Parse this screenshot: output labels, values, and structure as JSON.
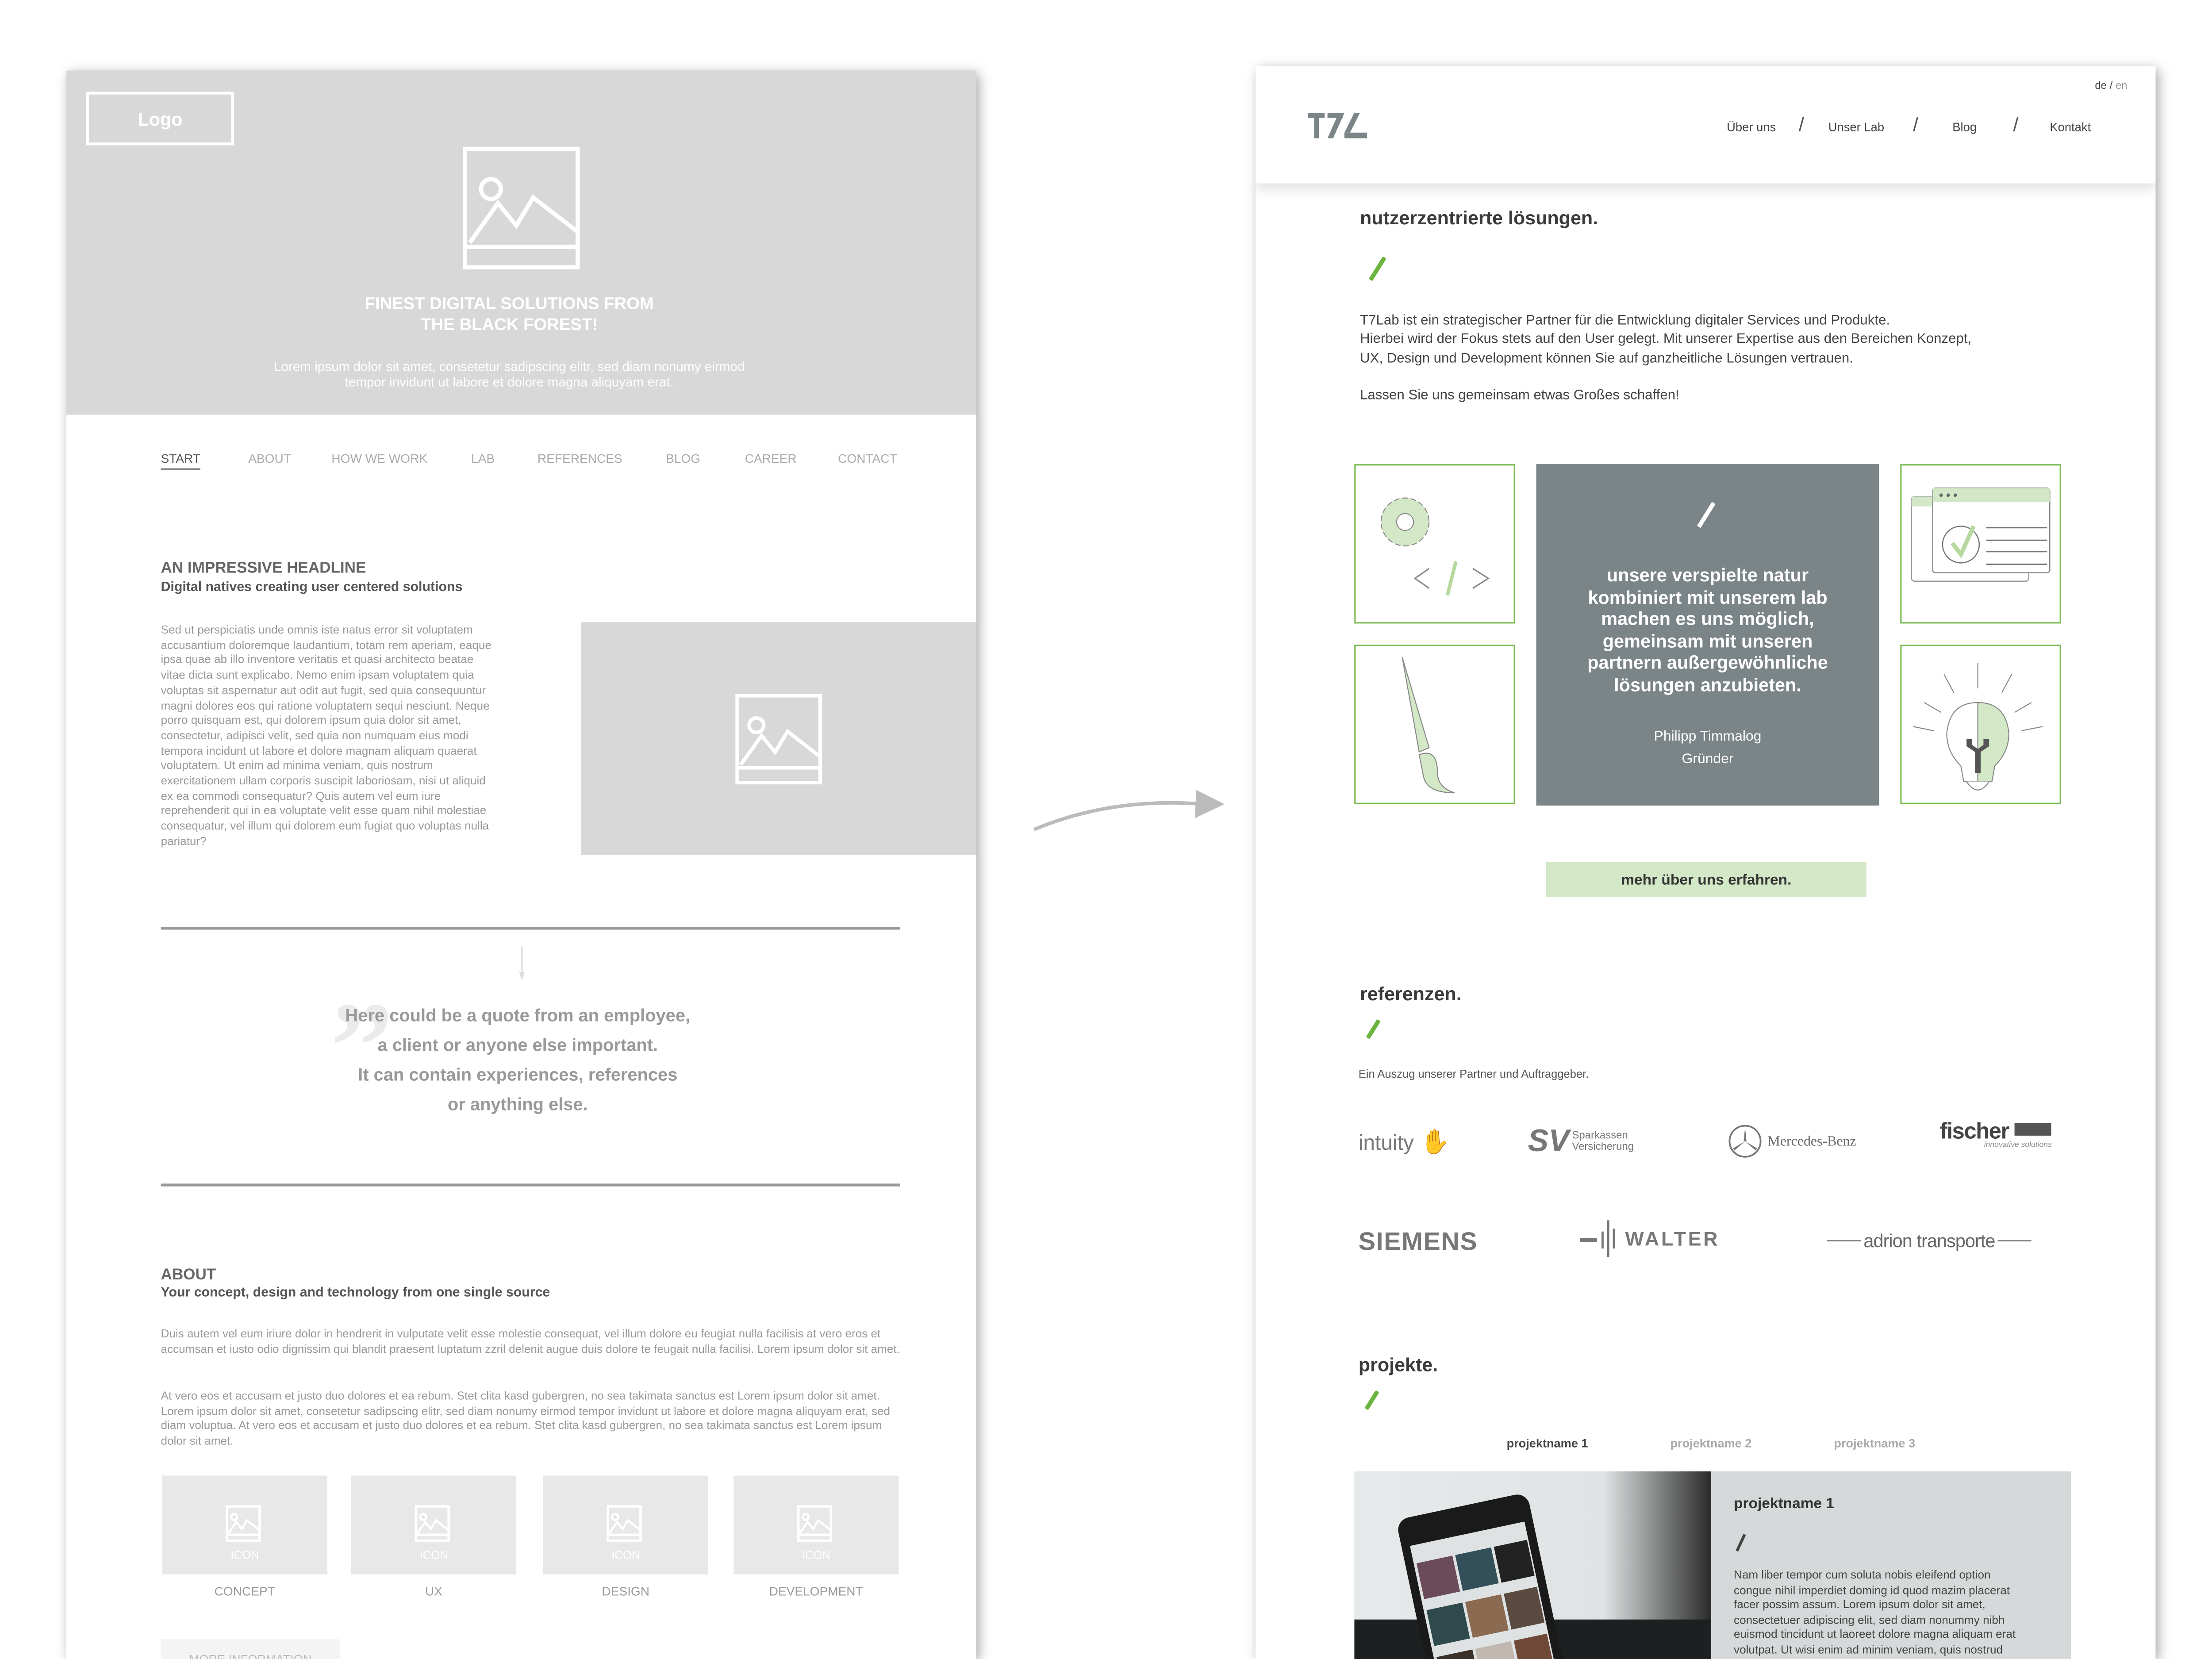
{
  "wireframe": {
    "logo": "Logo",
    "hero_title": [
      "FINEST DIGITAL SOLUTIONS FROM",
      "THE BLACK FOREST!"
    ],
    "hero_text": [
      "Lorem ipsum dolor sit amet, consetetur sadipscing elitr, sed diam nonumy eirmod",
      "tempor invidunt ut labore et dolore magna aliquyam erat."
    ],
    "nav": [
      "START",
      "ABOUT",
      "HOW WE WORK",
      "LAB",
      "REFERENCES",
      "BLOG",
      "CAREER",
      "CONTACT"
    ],
    "nav_active": "START",
    "headline": "AN IMPRESSIVE HEADLINE",
    "subheadline": "Digital natives creating user centered solutions",
    "body": "Sed ut perspiciatis unde omnis iste natus error sit voluptatem accusantium doloremque laudantium, totam rem aperiam, eaque ipsa quae ab illo inventore veritatis et quasi architecto beatae vitae dicta sunt explicabo. Nemo enim ipsam voluptatem quia voluptas sit aspernatur aut odit aut fugit, sed quia consequuntur magni dolores eos qui ratione voluptatem sequi nesciunt. Neque porro quisquam est, qui dolorem ipsum quia dolor sit amet, consectetur, adipisci velit, sed quia non numquam eius modi tempora incidunt ut labore et dolore magnam aliquam quaerat voluptatem. Ut enim ad minima veniam, quis nostrum exercitationem ullam corporis suscipit laboriosam, nisi ut aliquid ex ea commodi consequatur? Quis autem vel eum iure reprehenderit qui in ea voluptate velit esse quam nihil molestiae consequatur, vel illum qui dolorem eum fugiat quo voluptas nulla pariatur?",
    "quote": [
      "Here could be a quote from an employee,",
      "a client or anyone else important.",
      "It can contain experiences, references",
      "or anything else."
    ],
    "about_title": "ABOUT",
    "about_subtitle": "Your concept, design and technology from one single source",
    "about_p1": "Duis autem vel eum iriure dolor in hendrerit in vulputate velit esse molestie consequat, vel illum dolore eu feugiat nulla facilisis at vero eros et accumsan et iusto odio dignissim qui blandit praesent luptatum zzril delenit augue duis dolore te feugait nulla facilisi. Lorem ipsum dolor sit amet.",
    "about_p2": "At vero eos et accusam et justo duo dolores et ea rebum. Stet clita kasd gubergren, no sea takimata sanctus est Lorem ipsum dolor sit amet. Lorem ipsum dolor sit amet, consetetur sadipscing elitr, sed diam nonumy eirmod tempor invidunt ut labore et dolore magna aliquyam erat, sed diam voluptua. At vero eos et accusam et justo duo dolores et ea rebum. Stet clita kasd gubergren, no sea takimata sanctus est Lorem ipsum dolor sit amet.",
    "icon_placeholder": "ICON",
    "services": [
      "CONCEPT",
      "UX",
      "DESIGN",
      "DEVELOPMENT"
    ],
    "more_button": "MORE INFORMATION"
  },
  "design": {
    "lang": {
      "de": "de",
      "sep": "/",
      "en": "en"
    },
    "nav": [
      "Über uns",
      "Unser Lab",
      "Blog",
      "Kontakt"
    ],
    "intro_title": "nutzerzentrierte lösungen.",
    "intro_lines": [
      "T7Lab ist ein strategischer Partner für die Entwicklung digitaler Services und Produkte.",
      "Hierbei wird der Fokus stets auf den User gelegt. Mit unserer Expertise aus den Bereichen Konzept,",
      "UX, Design und Development können Sie auf ganzheitliche Lösungen vertrauen."
    ],
    "intro_cta_text": "Lassen Sie uns gemeinsam etwas Großes schaffen!",
    "quote_lines": [
      "unsere verspielte natur",
      "kombiniert mit unserem lab",
      "machen es uns möglich,",
      "gemeinsam mit unseren",
      "partnern außergewöhnliche",
      "lösungen  anzubieten."
    ],
    "quote_author": "Philipp Timmalog",
    "quote_role": "Gründer",
    "about_button": "mehr über uns erfahren.",
    "references_title": "referenzen.",
    "references_subtitle": "Ein Auszug unserer Partner und  Auftraggeber.",
    "reference_logos": {
      "intuity": "intuity",
      "sv_1": "Sparkassen",
      "sv_2": "Versicherung",
      "mercedes": "Mercedes-Benz",
      "fischer": "fischer",
      "fischer_tag": "innovative solutions",
      "siemens": "SIEMENS",
      "walter": "WALTER",
      "adrion": "adrion transporte"
    },
    "projects_title": "projekte.",
    "project_tabs": [
      "projektname 1",
      "projektname 2",
      "projektname 3"
    ],
    "active_project_tab": 0,
    "project_title": "projektname 1",
    "project_lines": [
      "Nam liber tempor cum soluta nobis eleifend option",
      "congue nihil imperdiet doming id quod mazim placerat",
      "facer possim assum. Lorem ipsum dolor sit amet,",
      "consectetuer adipiscing elit, sed diam nonummy nibh",
      "euismod tincidunt ut laoreet dolore magna aliquam erat",
      "volutpat. Ut wisi enim ad minim veniam, quis nostrud"
    ]
  },
  "colors": {
    "accent_green": "#6db33f",
    "light_green": "#d3e8c7",
    "slate": "#7b8487",
    "wireframe_gray": "#d8d8d8"
  }
}
